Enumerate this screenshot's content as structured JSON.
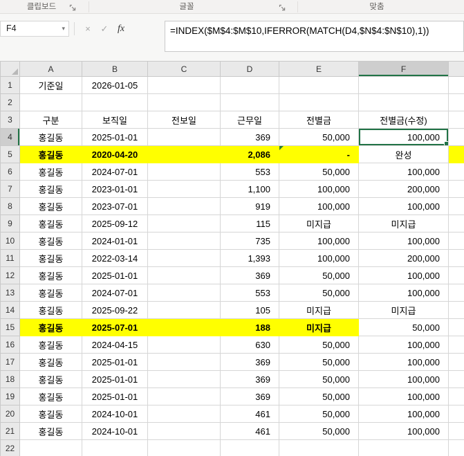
{
  "ribbon": {
    "groups": [
      {
        "label": "클립보드"
      },
      {
        "label": "글꼴"
      },
      {
        "label": "맞춤"
      }
    ]
  },
  "formula_bar": {
    "name_box": "F4",
    "dropdown_icon": "▾",
    "cancel": "×",
    "enter": "✓",
    "fx": "fx",
    "formula": "=INDEX($M$4:$M$10,IFERROR(MATCH(D4,$N$4:$N$10),1))"
  },
  "sheet": {
    "columns": [
      "A",
      "B",
      "C",
      "D",
      "E",
      "F"
    ],
    "selected_cell": {
      "col": "F",
      "row": 4
    },
    "error_indicator": {
      "col": "E",
      "row": 5
    },
    "colors": {
      "selection": "#217346",
      "highlight": "#ffff00",
      "error_indicator": "#2e7d32"
    },
    "rows": [
      {
        "n": 1,
        "cells": [
          "기준일",
          "2026-01-05",
          "",
          "",
          "",
          ""
        ]
      },
      {
        "n": 2,
        "cells": [
          "",
          "",
          "",
          "",
          "",
          ""
        ]
      },
      {
        "n": 3,
        "cells": [
          "구분",
          "보직일",
          "전보일",
          "근무일",
          "전별금",
          "전별금(수정)"
        ]
      },
      {
        "n": 4,
        "cells": [
          "홍길동",
          "2025-01-01",
          "",
          "369",
          "50,000",
          "100,000"
        ]
      },
      {
        "n": 5,
        "cells": [
          "홍길동",
          "2020-04-20",
          "",
          "2,086",
          "-",
          "완성"
        ],
        "yellow": true,
        "yellow_g": true
      },
      {
        "n": 6,
        "cells": [
          "홍길동",
          "2024-07-01",
          "",
          "553",
          "50,000",
          "100,000"
        ]
      },
      {
        "n": 7,
        "cells": [
          "홍길동",
          "2023-01-01",
          "",
          "1,100",
          "100,000",
          "200,000"
        ]
      },
      {
        "n": 8,
        "cells": [
          "홍길동",
          "2023-07-01",
          "",
          "919",
          "100,000",
          "100,000"
        ]
      },
      {
        "n": 9,
        "cells": [
          "홍길동",
          "2025-09-12",
          "",
          "115",
          "미지급",
          "미지급"
        ]
      },
      {
        "n": 10,
        "cells": [
          "홍길동",
          "2024-01-01",
          "",
          "735",
          "100,000",
          "100,000"
        ]
      },
      {
        "n": 11,
        "cells": [
          "홍길동",
          "2022-03-14",
          "",
          "1,393",
          "100,000",
          "200,000"
        ]
      },
      {
        "n": 12,
        "cells": [
          "홍길동",
          "2025-01-01",
          "",
          "369",
          "50,000",
          "100,000"
        ]
      },
      {
        "n": 13,
        "cells": [
          "홍길동",
          "2024-07-01",
          "",
          "553",
          "50,000",
          "100,000"
        ]
      },
      {
        "n": 14,
        "cells": [
          "홍길동",
          "2025-09-22",
          "",
          "105",
          "미지급",
          "미지급"
        ]
      },
      {
        "n": 15,
        "cells": [
          "홍길동",
          "2025-07-01",
          "",
          "188",
          "미지급",
          "50,000"
        ],
        "yellow": true
      },
      {
        "n": 16,
        "cells": [
          "홍길동",
          "2024-04-15",
          "",
          "630",
          "50,000",
          "100,000"
        ]
      },
      {
        "n": 17,
        "cells": [
          "홍길동",
          "2025-01-01",
          "",
          "369",
          "50,000",
          "100,000"
        ]
      },
      {
        "n": 18,
        "cells": [
          "홍길동",
          "2025-01-01",
          "",
          "369",
          "50,000",
          "100,000"
        ]
      },
      {
        "n": 19,
        "cells": [
          "홍길동",
          "2025-01-01",
          "",
          "369",
          "50,000",
          "100,000"
        ]
      },
      {
        "n": 20,
        "cells": [
          "홍길동",
          "2024-10-01",
          "",
          "461",
          "50,000",
          "100,000"
        ]
      },
      {
        "n": 21,
        "cells": [
          "홍길동",
          "2024-10-01",
          "",
          "461",
          "50,000",
          "100,000"
        ]
      },
      {
        "n": 22,
        "cells": [
          "",
          "",
          "",
          "",
          "",
          ""
        ]
      }
    ]
  }
}
